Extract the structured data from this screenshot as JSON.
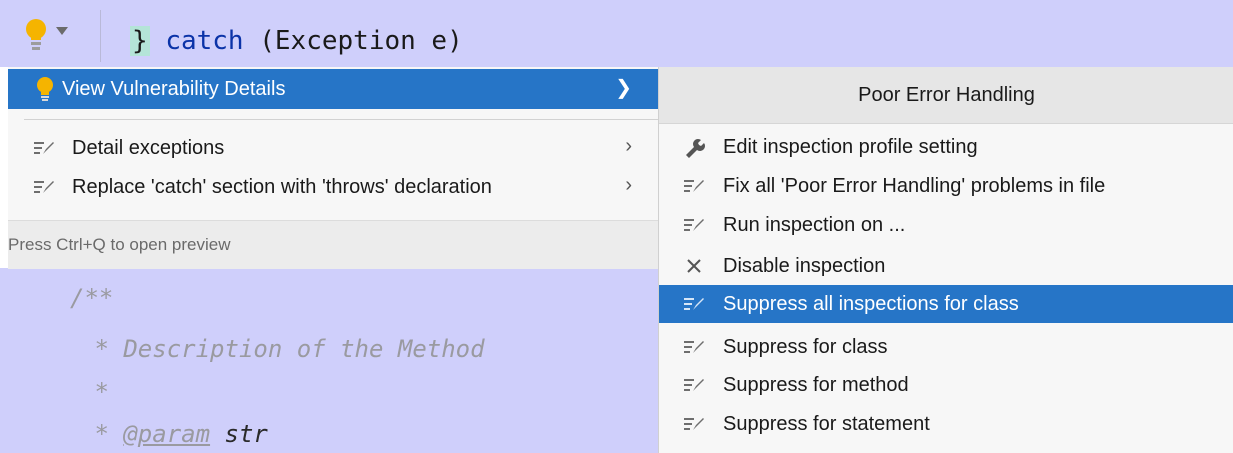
{
  "editor": {
    "code_line": {
      "brace": "}",
      "keyword": "catch",
      "rest": " (Exception e)"
    },
    "javadoc": {
      "line1": "/**",
      "line2": " * Description of the Method",
      "line3": " *",
      "line4_prefix": " * ",
      "line4_tag": "@param",
      "line4_arg": " str"
    }
  },
  "left_menu": {
    "items": [
      {
        "label": "View Vulnerability Details",
        "icon": "lightbulb-icon",
        "has_submenu": true,
        "selected": true
      },
      {
        "label": "Detail exceptions",
        "icon": "quickfix-icon",
        "has_submenu": true
      },
      {
        "label": "Replace 'catch' section with 'throws' declaration",
        "icon": "quickfix-icon",
        "has_submenu": true
      }
    ],
    "hint": "Press Ctrl+Q to open preview"
  },
  "right_menu": {
    "title": "Poor Error Handling",
    "items": [
      {
        "label": "Edit inspection profile setting",
        "icon": "wrench-icon"
      },
      {
        "label": "Fix all 'Poor Error Handling' problems in file",
        "icon": "quickfix-icon"
      },
      {
        "label": "Run inspection on ...",
        "icon": "quickfix-icon"
      },
      {
        "label": "Disable inspection",
        "icon": "close-icon"
      },
      {
        "label": "Suppress all inspections for class",
        "icon": "quickfix-icon",
        "selected": true
      },
      {
        "label": "Suppress for class",
        "icon": "quickfix-icon"
      },
      {
        "label": "Suppress for method",
        "icon": "quickfix-icon"
      },
      {
        "label": "Suppress for statement",
        "icon": "quickfix-icon"
      }
    ]
  },
  "colors": {
    "selection": "#2675c7",
    "code_highlight": "#cfcffb",
    "bulb": "#f5b400"
  }
}
